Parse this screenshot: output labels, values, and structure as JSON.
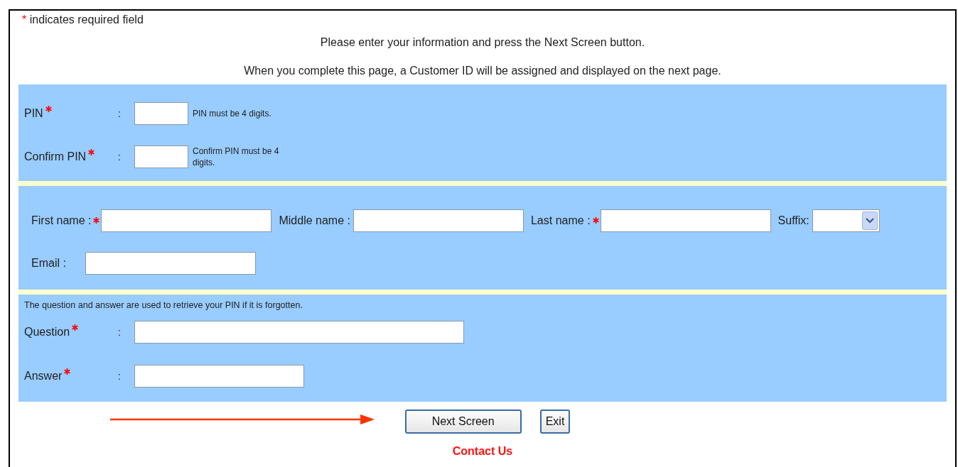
{
  "required_note": {
    "marker": "*",
    "text": "indicates required field"
  },
  "instructions": [
    "Please enter your information and press the Next Screen button.",
    "When you complete this page, a Customer ID will be assigned and displayed on the next page."
  ],
  "sections": [
    {
      "kind": "rows",
      "fields": [
        {
          "label": "PIN",
          "required": true,
          "separator": ":",
          "kind": "text",
          "hint": "PIN must be 4 digits."
        },
        {
          "label": "Confirm PIN",
          "required": true,
          "separator": ":",
          "kind": "text",
          "hint": "Confirm PIN must be 4 digits."
        }
      ]
    },
    {
      "kind": "inline",
      "fields": [
        {
          "label": "First name :",
          "required": true,
          "kind": "text"
        },
        {
          "label": "Middle name :",
          "required": false,
          "kind": "text"
        },
        {
          "label": "Last name :",
          "required": true,
          "kind": "text"
        },
        {
          "label": "Suffix:",
          "required": false,
          "kind": "select"
        },
        {
          "label": "Email :",
          "required": false,
          "kind": "text"
        }
      ]
    },
    {
      "kind": "rows",
      "note": "The question and answer are used to retrieve your PIN if it is forgotten.",
      "fields": [
        {
          "label": "Question",
          "required": true,
          "separator": ":",
          "kind": "text"
        },
        {
          "label": "Answer",
          "required": true,
          "separator": ":",
          "kind": "text"
        }
      ]
    }
  ],
  "buttons": [
    "Next Screen",
    "Exit"
  ],
  "contact_link": "Contact Us"
}
